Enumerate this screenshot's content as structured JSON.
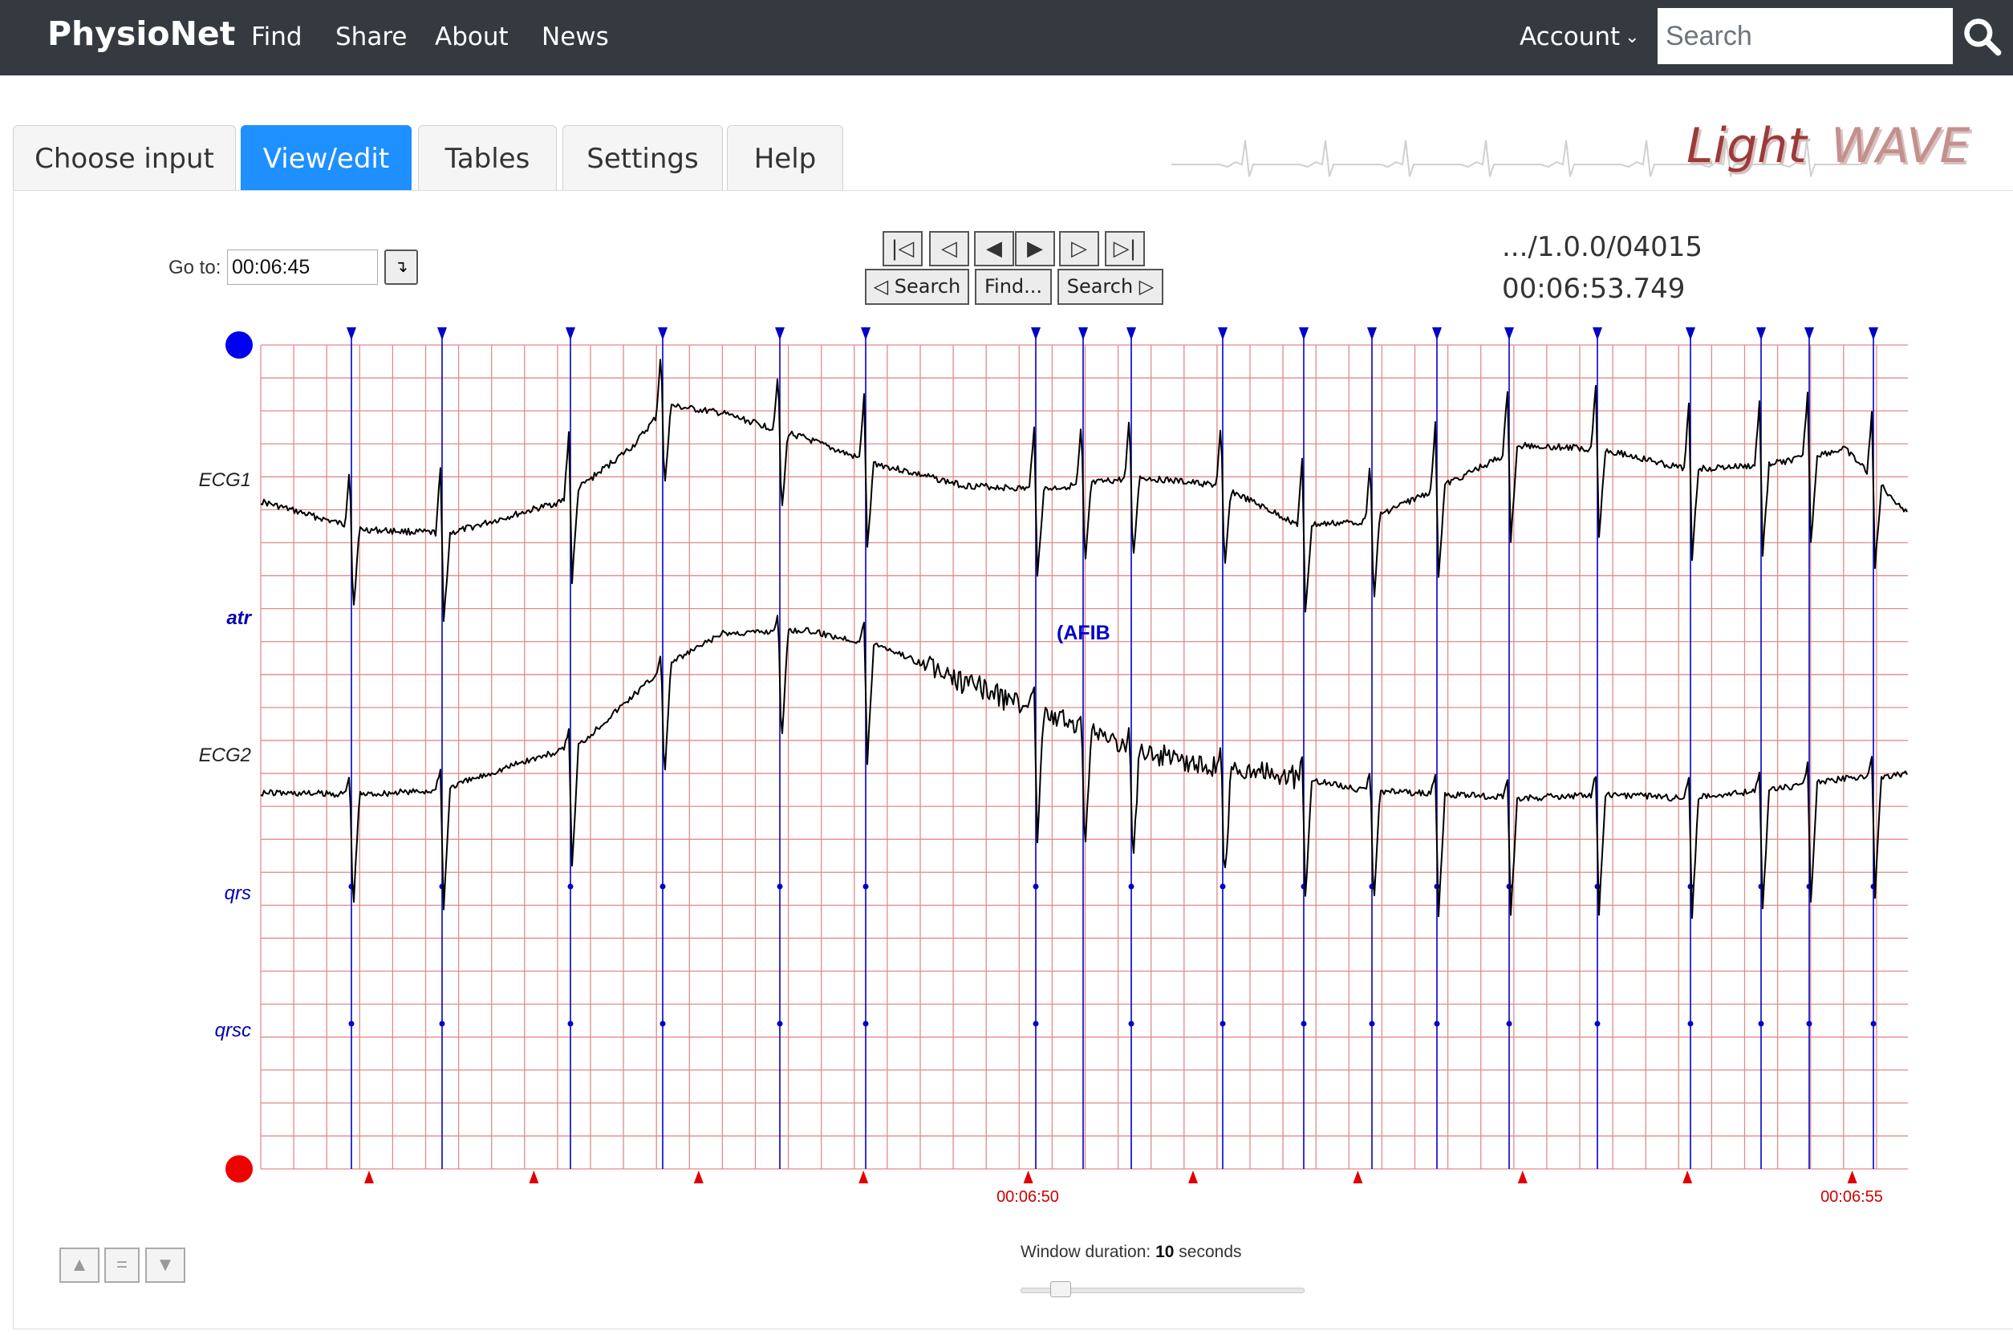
{
  "navbar": {
    "brand": "PhysioNet",
    "links": [
      "Find",
      "Share",
      "About",
      "News"
    ],
    "account_label": "Account",
    "search_placeholder": "Search"
  },
  "tabs": [
    "Choose input",
    "View/edit",
    "Tables",
    "Settings",
    "Help"
  ],
  "active_tab": "View/edit",
  "logo": {
    "part1": "Light",
    "part2": "WAVE"
  },
  "goto": {
    "label": "Go to:",
    "value": "00:06:45",
    "button_glyph": "↴"
  },
  "nav_buttons": [
    "|◁",
    "◁",
    "◀",
    "▶",
    "▷",
    "▷|"
  ],
  "search_buttons": [
    "◁ Search",
    "Find...",
    "Search ▷"
  ],
  "record": {
    "path": ".../1.0.0/04015",
    "time": "00:06:53.749"
  },
  "signals": {
    "ecg1": "ECG1",
    "atr": "atr",
    "ecg2": "ECG2",
    "qrs": "qrs",
    "qrsc": "qrsc"
  },
  "rhythm_annotation": "(AFIB",
  "time_labels": [
    "00:06:50",
    "00:06:55"
  ],
  "window_duration": {
    "label": "Window duration:",
    "value": "10",
    "unit": "seconds"
  },
  "signal_buttons": [
    "▲",
    "=",
    "▼"
  ],
  "colors": {
    "navbar": "#343a40",
    "active_tab": "#1e90ff",
    "grid": "#e08a8a",
    "annotation": "#0000c8",
    "trace": "#000000",
    "time_marker": "#e00000"
  }
}
